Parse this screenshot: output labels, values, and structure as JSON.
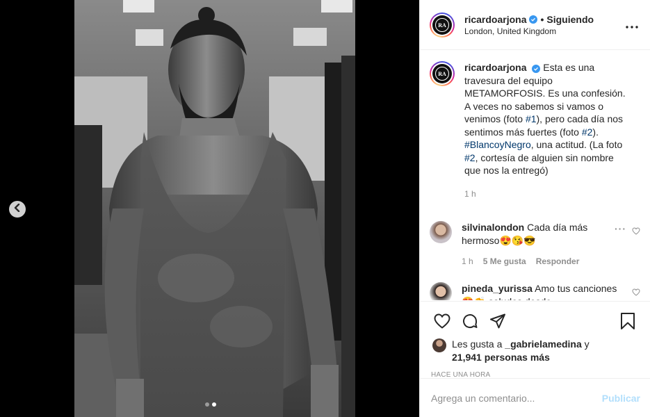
{
  "post": {
    "username": "ricardoarjona",
    "follow_status": "Siguiendo",
    "bullet": "•",
    "location": "London, United Kingdom",
    "more_icon": "more-horizontal-icon",
    "avatar_initials": "RA"
  },
  "caption": {
    "username": "ricardoarjona",
    "text_1": "Esta es una travesura del equipo METAMORFOSIS. Es una confesión. A veces no sabemos si vamos o venimos (foto ",
    "tag_1": "#1",
    "text_2": "), pero cada día nos sentimos más fuertes (foto ",
    "tag_2": "#2",
    "text_3": "). ",
    "tag_3": "#BlancoyNegro",
    "text_4": ", una actitud. (La foto ",
    "tag_4": "#2",
    "text_5": ", cortesía de alguien sin nombre que nos la entregó)",
    "time": "1 h"
  },
  "comments": [
    {
      "username": "silvinalondon",
      "text": "Cada día más hermoso😍😘😎",
      "time": "1 h",
      "likes": "5 Me gusta",
      "reply": "Responder",
      "more": "···"
    },
    {
      "username": "pineda_yurissa",
      "text": "Amo tus canciones 😍👏 saludos desde"
    }
  ],
  "likes": {
    "prefix": "Les gusta a ",
    "user": "_gabrielamedina",
    "middle": " y",
    "count": "21,941 personas más"
  },
  "timestamp": "HACE UNA HORA",
  "add_comment": {
    "placeholder": "Agrega un comentario...",
    "publish": "Publicar"
  },
  "colors": {
    "verified": "#3897f0",
    "link": "#00376b",
    "muted": "#8e8e8e",
    "publish_disabled": "#b2dffc"
  },
  "carousel": {
    "slides": 2,
    "active_slide": 2
  }
}
